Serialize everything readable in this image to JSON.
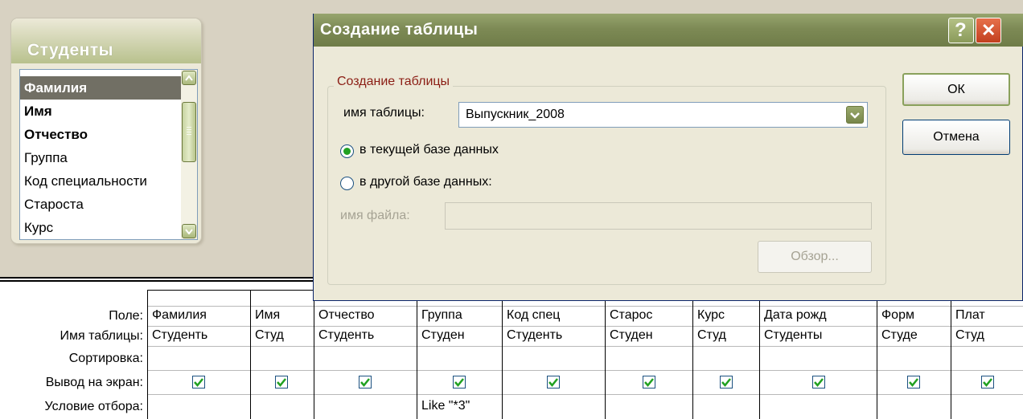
{
  "field_list": {
    "title": "Студенты",
    "items": [
      {
        "label": "Фамилия"
      },
      {
        "label": "Имя"
      },
      {
        "label": "Отчество"
      },
      {
        "label": "Группа"
      },
      {
        "label": "Код специальности"
      },
      {
        "label": "Староста"
      },
      {
        "label": "Курс"
      }
    ]
  },
  "grid": {
    "row_labels": {
      "field": "Поле:",
      "table": "Имя таблицы:",
      "sort": "Сортировка:",
      "show": "Вывод на экран:",
      "criteria": "Условие отбора:"
    },
    "columns": [
      {
        "field": "Фамилия",
        "table": "Студенть",
        "criteria": ""
      },
      {
        "field": "Имя",
        "table": "Студ",
        "criteria": ""
      },
      {
        "field": "Отчество",
        "table": "Студенть",
        "criteria": ""
      },
      {
        "field": "Группа",
        "table": "Студен",
        "criteria": "Like \"*3\""
      },
      {
        "field": "Код спец",
        "table": "Студенть",
        "criteria": ""
      },
      {
        "field": "Старос",
        "table": "Студен",
        "criteria": ""
      },
      {
        "field": "Курс",
        "table": "Студ",
        "criteria": ""
      },
      {
        "field": "Дата рожд",
        "table": "Студенты",
        "criteria": ""
      },
      {
        "field": "Форм",
        "table": "Студе",
        "criteria": ""
      },
      {
        "field": "Плат",
        "table": "Студ",
        "criteria": ""
      }
    ]
  },
  "dialog": {
    "title": "Создание таблицы",
    "help_glyph": "?",
    "close_glyph": "✕",
    "group_title": "Создание таблицы",
    "table_name_label": "имя таблицы:",
    "table_name_value": "Выпускник_2008",
    "radio_current": "в текущей базе данных",
    "radio_other": "в другой базе данных:",
    "file_name_label": "имя файла:",
    "ok_label": "ОК",
    "cancel_label": "Отмена",
    "browse_label": "Обзор..."
  },
  "colors": {
    "title_bar": "#7d8a55",
    "selection": "#716f64",
    "accent_green": "#21a121",
    "group_title": "#8b1d14",
    "close_button": "#c2401f"
  }
}
